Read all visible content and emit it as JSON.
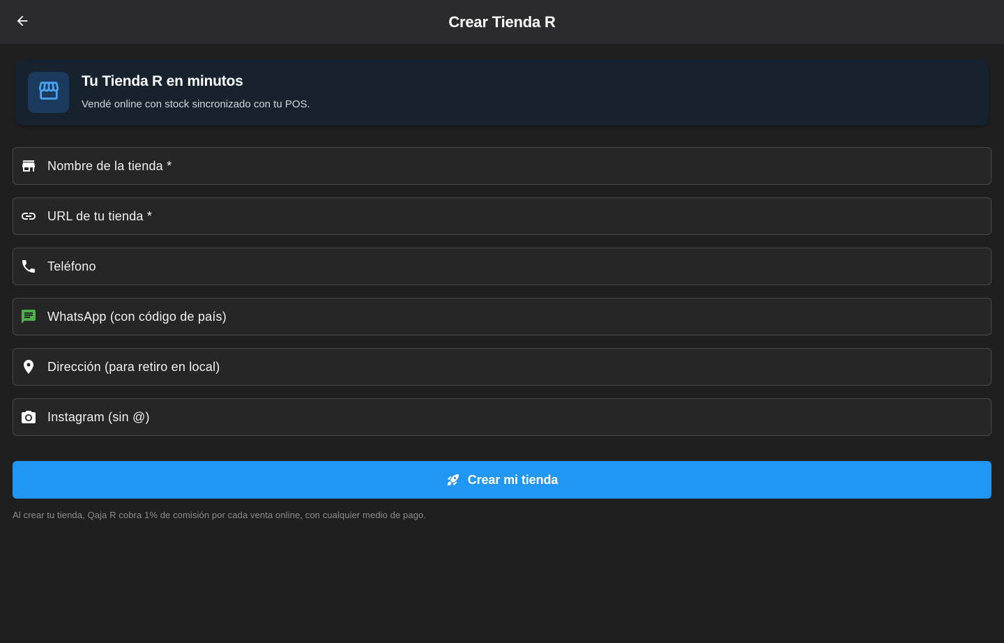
{
  "appbar": {
    "title": "Crear Tienda R",
    "back_icon": "arrow-back-icon"
  },
  "banner": {
    "icon": "storefront-icon",
    "title": "Tu Tienda R en minutos",
    "subtitle": "Vendé online con stock sincronizado con tu POS."
  },
  "form": {
    "fields": [
      {
        "icon": "store-icon",
        "label": "Nombre de la tienda *",
        "value": ""
      },
      {
        "icon": "link-icon",
        "label": "URL de tu tienda *",
        "value": ""
      },
      {
        "icon": "phone-icon",
        "label": "Teléfono",
        "value": ""
      },
      {
        "icon": "chat-icon",
        "label": "WhatsApp (con código de país)",
        "value": ""
      },
      {
        "icon": "location-pin-icon",
        "label": "Dirección (para retiro en local)",
        "value": ""
      },
      {
        "icon": "camera-icon",
        "label": "Instagram (sin @)",
        "value": ""
      }
    ]
  },
  "submit": {
    "icon": "rocket-icon",
    "label": "Crear mi tienda"
  },
  "footnote": "Al crear tu tienda, Qaja R cobra 1% de comisión por cada venta online, con cualquier medio de pago.",
  "colors": {
    "primary": "#2196f3",
    "background": "#1f1f1f",
    "appbar": "#2b2b2d",
    "banner": "#17222f",
    "whatsapp_icon": "#4caf50"
  }
}
